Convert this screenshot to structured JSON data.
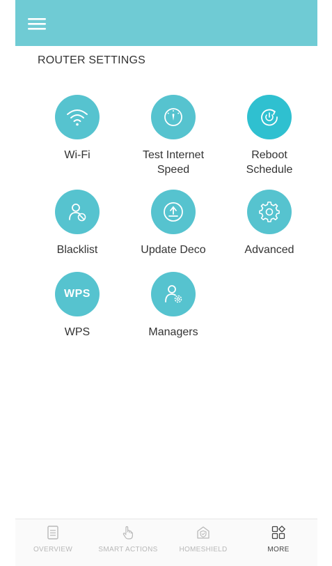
{
  "header": {
    "section_title": "ROUTER SETTINGS"
  },
  "tiles": [
    {
      "label": "Wi-Fi",
      "icon": "wifi-icon"
    },
    {
      "label": "Test Internet\nSpeed",
      "icon": "speedometer-icon"
    },
    {
      "label": "Reboot\nSchedule",
      "icon": "reboot-icon"
    },
    {
      "label": "Blacklist",
      "icon": "blocked-user-icon"
    },
    {
      "label": "Update Deco",
      "icon": "upload-icon"
    },
    {
      "label": "Advanced",
      "icon": "gear-icon"
    },
    {
      "label": "WPS",
      "icon": "wps-icon"
    },
    {
      "label": "Managers",
      "icon": "user-gear-icon"
    }
  ],
  "wps_badge": "WPS",
  "bottom_nav": [
    {
      "label": "OVERVIEW",
      "icon": "document-icon",
      "active": false
    },
    {
      "label": "SMART ACTIONS",
      "icon": "hand-tap-icon",
      "active": false
    },
    {
      "label": "HOMESHIELD",
      "icon": "home-shield-icon",
      "active": false
    },
    {
      "label": "MORE",
      "icon": "grid-more-icon",
      "active": true
    }
  ],
  "colors": {
    "topbar": "#6fcbd4",
    "tile_circle": "#56c3cf",
    "tile_circle_active": "#2fc0d0",
    "nav_inactive": "#b8b8b8",
    "nav_active": "#444444"
  }
}
